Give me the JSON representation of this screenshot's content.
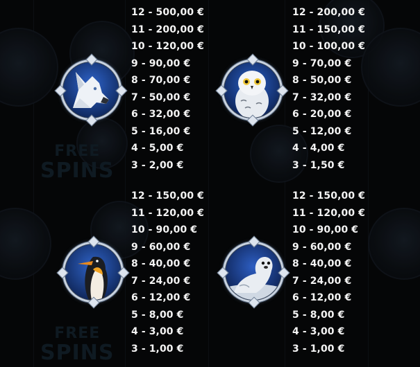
{
  "paytable": [
    {
      "symbol": "wolf-symbol",
      "payouts": [
        "12 - 500,00 €",
        "11 - 200,00 €",
        "10 - 120,00 €",
        "9 - 90,00 €",
        "8 - 70,00 €",
        "7 - 50,00 €",
        "6 - 32,00 €",
        "5 - 16,00 €",
        "4 - 5,00 €",
        "3 - 2,00 €"
      ]
    },
    {
      "symbol": "owl-symbol",
      "payouts": [
        "12 - 200,00 €",
        "11 - 150,00 €",
        "10 - 100,00 €",
        "9 - 70,00 €",
        "8 - 50,00 €",
        "7 - 32,00 €",
        "6 - 20,00 €",
        "5 - 12,00 €",
        "4 - 4,00 €",
        "3 - 1,50 €"
      ]
    },
    {
      "symbol": "penguin-symbol",
      "payouts": [
        "12 - 150,00 €",
        "11 - 120,00 €",
        "10 - 90,00 €",
        "9 - 60,00 €",
        "8 - 40,00 €",
        "7 - 24,00 €",
        "6 - 12,00 €",
        "5 - 8,00 €",
        "4 - 3,00 €",
        "3 - 1,00 €"
      ]
    },
    {
      "symbol": "seal-symbol",
      "payouts": [
        "12 - 150,00 €",
        "11 - 120,00 €",
        "10 - 90,00 €",
        "9 - 60,00 €",
        "8 - 40,00 €",
        "7 - 24,00 €",
        "6 - 12,00 €",
        "5 - 8,00 €",
        "4 - 3,00 €",
        "3 - 1,00 €"
      ]
    }
  ],
  "background": {
    "watermark_top": "FREE",
    "watermark_bottom": "SPINS"
  },
  "colors": {
    "background": "#050607",
    "text": "#f4f4f4",
    "medal_ring": "#c9d3e0",
    "medal_sky": "#1a3f8c"
  }
}
